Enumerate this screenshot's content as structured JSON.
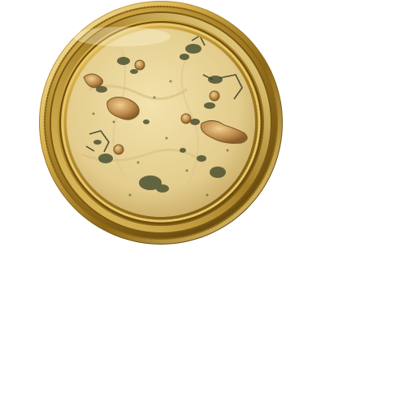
{
  "minimap": {
    "frame_color": "#c9a23a",
    "frame_dark": "#6e4f10",
    "frame_light": "#f4dd8c",
    "parchment_color": "#e6d39b",
    "parchment_dark": "#c9b070",
    "terrain_color": "#4c5232",
    "mound_color": "#b9884a",
    "icons": [
      "gold-bezel-frame",
      "beaded-rim",
      "parchment-map",
      "mound-marker",
      "vegetation-patch",
      "ruin-outline"
    ]
  }
}
